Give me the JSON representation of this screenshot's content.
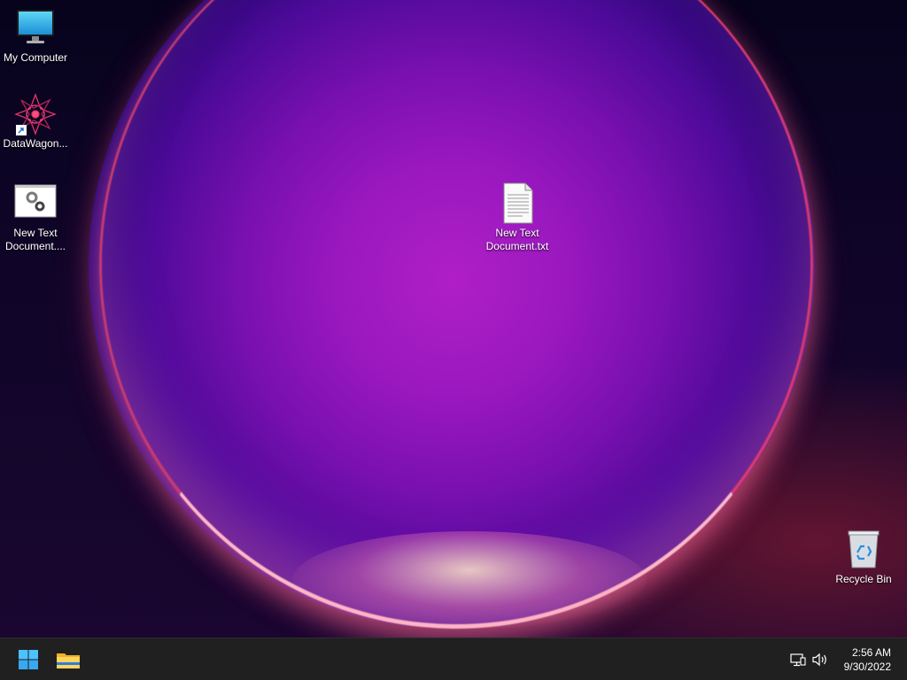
{
  "desktop": {
    "icons": [
      {
        "label": "My Computer",
        "icon": "monitor-icon"
      },
      {
        "label": "DataWagon...",
        "icon": "datawagon-app-icon",
        "shortcut": true
      },
      {
        "label_line1": "New Text",
        "label_line2": "Document....",
        "icon": "settings-file-icon"
      },
      {
        "label_line1": "New Text",
        "label_line2": "Document.txt",
        "icon": "text-file-icon"
      },
      {
        "label": "Recycle Bin",
        "icon": "recycle-bin-icon"
      }
    ]
  },
  "taskbar": {
    "start_icon": "windows-start-icon",
    "pinned": [
      "file-explorer-icon"
    ],
    "tray": [
      "network-icon",
      "volume-icon"
    ],
    "time": "2:56 AM",
    "date": "9/30/2022"
  },
  "colors": {
    "taskbar_bg": "#202020",
    "windows_logo": "#4cc2ff",
    "orb_core": "#b01fc6"
  }
}
